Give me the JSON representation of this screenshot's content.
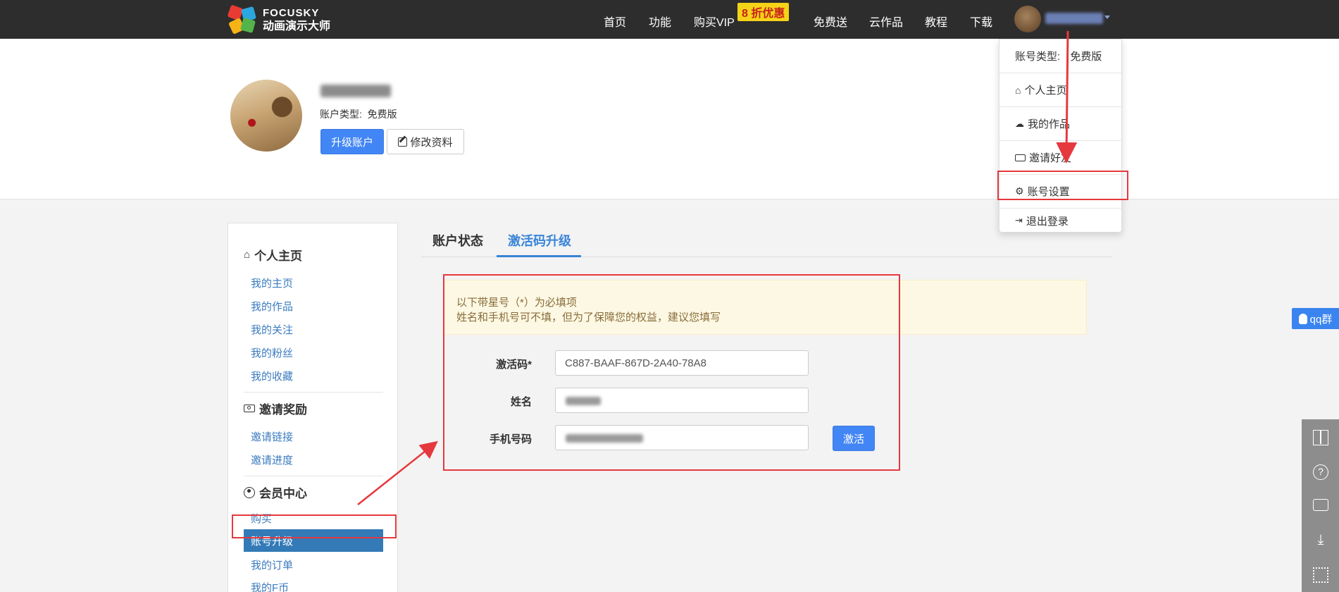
{
  "brand": {
    "name_en": "FOCUSKY",
    "name_cn": "动画演示大师"
  },
  "nav": {
    "items": [
      "首页",
      "功能",
      "购买VIP",
      "免费送",
      "云作品",
      "教程",
      "下载"
    ],
    "promo": "8 折优惠"
  },
  "profile": {
    "account_type_label": "账户类型:",
    "account_type_value": "免费版",
    "upgrade_button": "升级账户",
    "edit_button": "修改资料"
  },
  "sidebar": {
    "sections": [
      {
        "title": "个人主页",
        "icon": "home-icon",
        "items": [
          "我的主页",
          "我的作品",
          "我的关注",
          "我的粉丝",
          "我的收藏"
        ]
      },
      {
        "title": "邀请奖励",
        "icon": "money-icon",
        "items": [
          "邀请链接",
          "邀请进度"
        ]
      },
      {
        "title": "会员中心",
        "icon": "user-circle-icon",
        "items": [
          "购买",
          "账号升级",
          "我的订单",
          "我的F币"
        ]
      }
    ],
    "active_item": "账号升级"
  },
  "tabs": [
    {
      "label": "账户状态",
      "active": false
    },
    {
      "label": "激活码升级",
      "active": true
    }
  ],
  "notice": {
    "line1": "以下带星号（*）为必填项",
    "line2": "姓名和手机号可不填，但为了保障您的权益，建议您填写"
  },
  "form": {
    "code_label": "激活码*",
    "code_value": "C887-BAAF-867D-2A40-78A8",
    "name_label": "姓名",
    "phone_label": "手机号码",
    "activate_button": "激活"
  },
  "dropdown": {
    "account_type_label": "账号类型:",
    "account_type_value": "免费版",
    "items": [
      {
        "label": "个人主页",
        "icon": "home-icon"
      },
      {
        "label": "我的作品",
        "icon": "cloud-upload-icon"
      },
      {
        "label": "邀请好友",
        "icon": "money-icon"
      },
      {
        "label": "账号设置",
        "icon": "gear-icon"
      },
      {
        "label": "退出登录",
        "icon": "sign-out-icon"
      }
    ]
  },
  "float": {
    "qq_label": "qq群"
  },
  "colors": {
    "accent": "#4286f5",
    "annotation": "#e5393e",
    "topbar": "#2d2d2d",
    "sidebar_active": "#337ab7"
  }
}
